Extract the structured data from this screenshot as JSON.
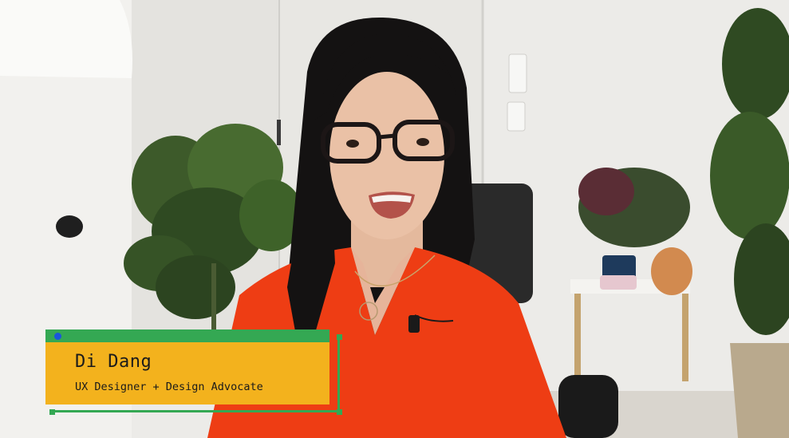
{
  "video": {
    "description_icon": "video-frame"
  },
  "lower_third": {
    "name": "Di Dang",
    "title": "UX Designer + Design Advocate",
    "accent_color": "#34a853",
    "card_color": "#f3b21d",
    "dot_color": "#1a56db"
  }
}
